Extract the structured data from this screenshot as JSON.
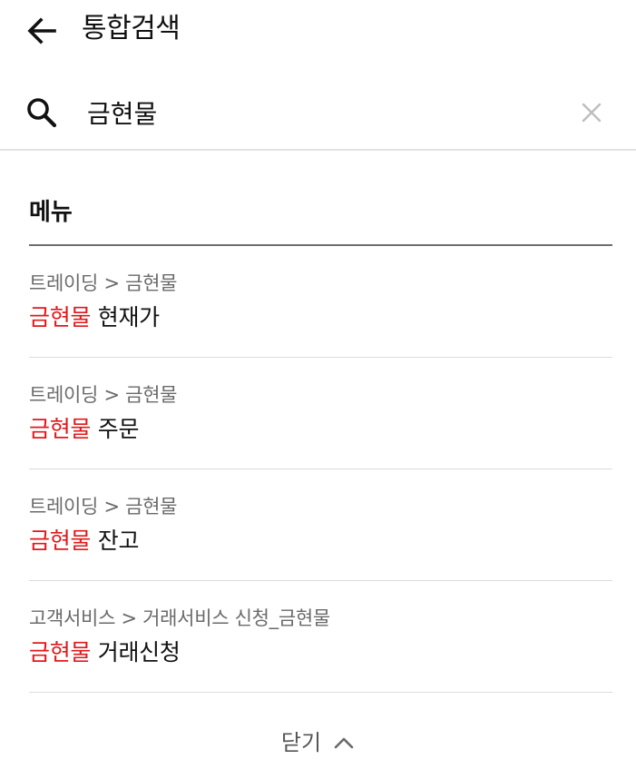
{
  "header": {
    "title": "통합검색"
  },
  "search": {
    "value": "금현물",
    "placeholder": ""
  },
  "section": {
    "title": "메뉴"
  },
  "results": [
    {
      "path": "트레이딩 > 금현물",
      "highlight": "금현물",
      "rest": " 현재가"
    },
    {
      "path": "트레이딩 > 금현물",
      "highlight": "금현물",
      "rest": " 주문"
    },
    {
      "path": "트레이딩 > 금현물",
      "highlight": "금현물",
      "rest": " 잔고"
    },
    {
      "path": "고객서비스 > 거래서비스 신청_금현물",
      "highlight": "금현물",
      "rest": " 거래신청"
    }
  ],
  "footer": {
    "close_label": "닫기"
  },
  "colors": {
    "highlight": "#e0191c",
    "path_text": "#6a6a6a",
    "divider": "#dcdcdc"
  },
  "icons": {
    "back": "arrow-left-icon",
    "search": "search-icon",
    "clear": "close-icon",
    "collapse": "chevron-up-icon"
  }
}
